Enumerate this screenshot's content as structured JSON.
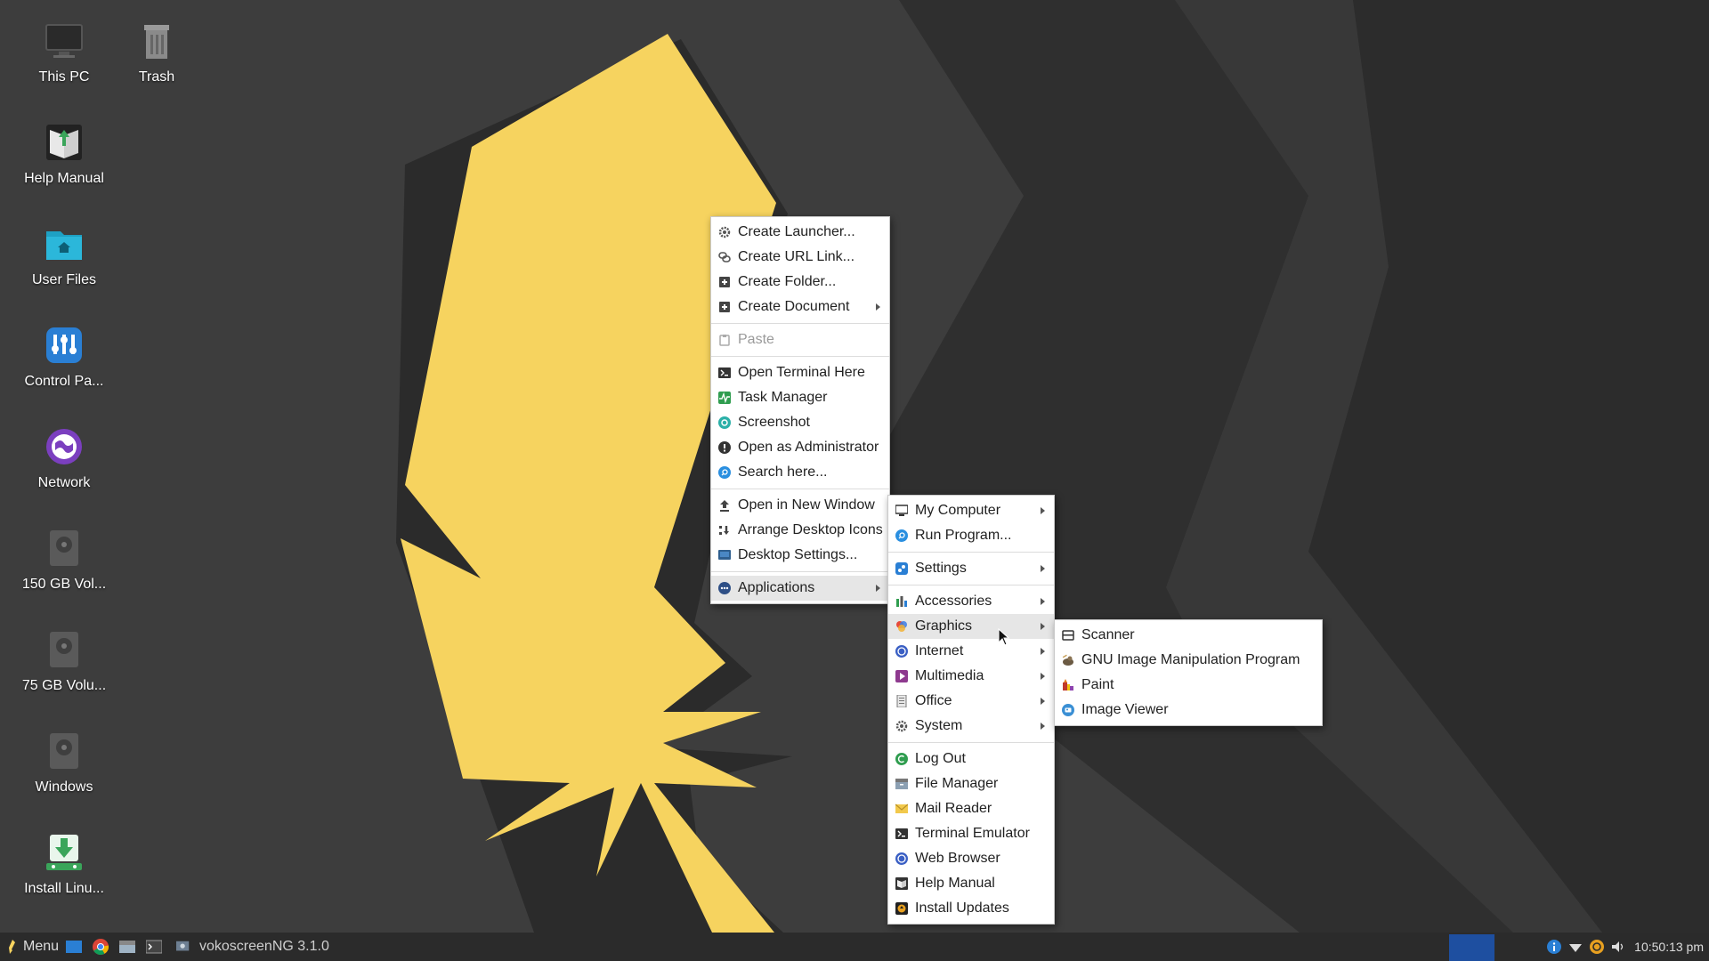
{
  "desktop": {
    "icons": [
      {
        "label": "This PC",
        "icon": "monitor-icon"
      },
      {
        "label": "Trash",
        "icon": "trash-icon"
      },
      {
        "label": "Help Manual",
        "icon": "help-manual-icon"
      },
      {
        "label": "User Files",
        "icon": "home-folder-icon"
      },
      {
        "label": "Control Pa...",
        "icon": "control-panel-icon"
      },
      {
        "label": "Network",
        "icon": "network-globe-icon"
      },
      {
        "label": "150 GB Vol...",
        "icon": "drive-icon"
      },
      {
        "label": "75 GB Volu...",
        "icon": "drive-icon"
      },
      {
        "label": "Windows",
        "icon": "drive-icon"
      },
      {
        "label": "Install Linu...",
        "icon": "install-icon"
      }
    ]
  },
  "context_menu": {
    "items": [
      {
        "label": "Create Launcher...",
        "icon": "gear-icon"
      },
      {
        "label": "Create URL Link...",
        "icon": "link-icon"
      },
      {
        "label": "Create Folder...",
        "icon": "new-folder-icon"
      },
      {
        "label": "Create Document",
        "icon": "new-document-icon",
        "submenu": true
      },
      {
        "label": "Paste",
        "icon": "clipboard-icon",
        "disabled": true
      },
      {
        "label": "Open Terminal Here",
        "icon": "terminal-icon"
      },
      {
        "label": "Task Manager",
        "icon": "task-manager-icon"
      },
      {
        "label": "Screenshot",
        "icon": "screenshot-icon"
      },
      {
        "label": "Open as Administrator",
        "icon": "admin-icon"
      },
      {
        "label": "Search here...",
        "icon": "search-icon"
      },
      {
        "label": "Open in New Window",
        "icon": "upload-arrow-icon"
      },
      {
        "label": "Arrange Desktop Icons",
        "icon": "arrange-icon"
      },
      {
        "label": "Desktop Settings...",
        "icon": "desktop-settings-icon"
      },
      {
        "label": "Applications",
        "icon": "applications-icon",
        "submenu": true,
        "active": true
      }
    ]
  },
  "applications_menu": {
    "items": [
      {
        "label": "My Computer",
        "icon": "monitor-icon",
        "submenu": true
      },
      {
        "label": "Run Program...",
        "icon": "run-icon"
      },
      {
        "label": "Settings",
        "icon": "settings-icon",
        "submenu": true
      },
      {
        "label": "Accessories",
        "icon": "accessories-icon",
        "submenu": true
      },
      {
        "label": "Graphics",
        "icon": "graphics-icon",
        "submenu": true,
        "active": true
      },
      {
        "label": "Internet",
        "icon": "internet-icon",
        "submenu": true
      },
      {
        "label": "Multimedia",
        "icon": "multimedia-icon",
        "submenu": true
      },
      {
        "label": "Office",
        "icon": "office-icon",
        "submenu": true
      },
      {
        "label": "System",
        "icon": "system-gear-icon",
        "submenu": true
      },
      {
        "label": "Log Out",
        "icon": "logout-icon"
      },
      {
        "label": "File Manager",
        "icon": "file-manager-icon"
      },
      {
        "label": "Mail Reader",
        "icon": "mail-icon"
      },
      {
        "label": "Terminal Emulator",
        "icon": "terminal-icon"
      },
      {
        "label": "Web Browser",
        "icon": "web-browser-icon"
      },
      {
        "label": "Help Manual",
        "icon": "help-manual-icon"
      },
      {
        "label": "Install Updates",
        "icon": "updates-icon"
      }
    ]
  },
  "graphics_menu": {
    "items": [
      {
        "label": "Scanner",
        "icon": "scanner-icon"
      },
      {
        "label": "GNU Image Manipulation Program",
        "icon": "gimp-icon"
      },
      {
        "label": "Paint",
        "icon": "paint-icon"
      },
      {
        "label": "Image Viewer",
        "icon": "image-viewer-icon"
      }
    ]
  },
  "taskbar": {
    "menu_label": "Menu",
    "window_title": "vokoscreenNG 3.1.0",
    "clock": "10:50:13 pm"
  },
  "colors": {
    "wallpaper_bg": "#3d3d3d",
    "wallpaper_yellow": "#f6d35f",
    "menu_bg": "#ffffff",
    "taskbar_bg": "#2b2b2b",
    "taskbar_active": "#1e4fa0"
  }
}
